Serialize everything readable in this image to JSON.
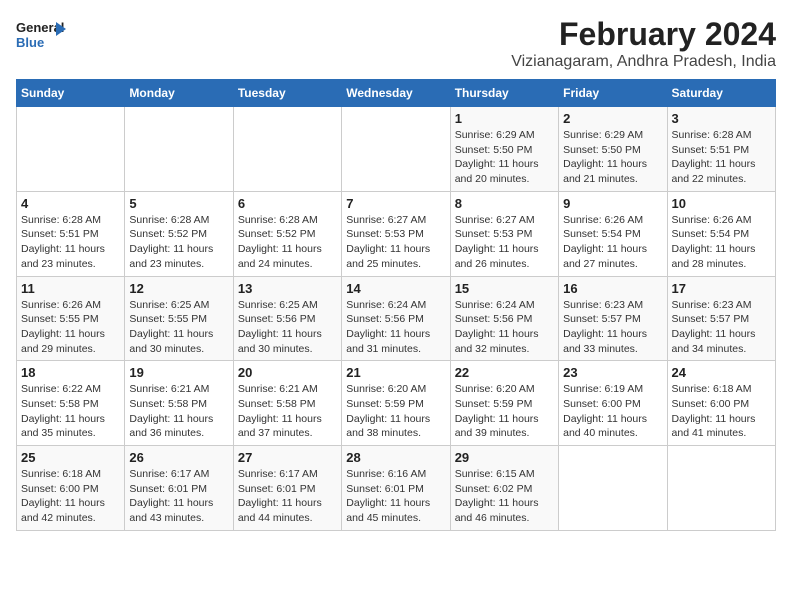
{
  "logo": {
    "general": "General",
    "blue": "Blue"
  },
  "title": "February 2024",
  "subtitle": "Vizianagaram, Andhra Pradesh, India",
  "days_header": [
    "Sunday",
    "Monday",
    "Tuesday",
    "Wednesday",
    "Thursday",
    "Friday",
    "Saturday"
  ],
  "weeks": [
    [
      {
        "day": "",
        "info": ""
      },
      {
        "day": "",
        "info": ""
      },
      {
        "day": "",
        "info": ""
      },
      {
        "day": "",
        "info": ""
      },
      {
        "day": "1",
        "info": "Sunrise: 6:29 AM\nSunset: 5:50 PM\nDaylight: 11 hours and 20 minutes."
      },
      {
        "day": "2",
        "info": "Sunrise: 6:29 AM\nSunset: 5:50 PM\nDaylight: 11 hours and 21 minutes."
      },
      {
        "day": "3",
        "info": "Sunrise: 6:28 AM\nSunset: 5:51 PM\nDaylight: 11 hours and 22 minutes."
      }
    ],
    [
      {
        "day": "4",
        "info": "Sunrise: 6:28 AM\nSunset: 5:51 PM\nDaylight: 11 hours and 23 minutes."
      },
      {
        "day": "5",
        "info": "Sunrise: 6:28 AM\nSunset: 5:52 PM\nDaylight: 11 hours and 23 minutes."
      },
      {
        "day": "6",
        "info": "Sunrise: 6:28 AM\nSunset: 5:52 PM\nDaylight: 11 hours and 24 minutes."
      },
      {
        "day": "7",
        "info": "Sunrise: 6:27 AM\nSunset: 5:53 PM\nDaylight: 11 hours and 25 minutes."
      },
      {
        "day": "8",
        "info": "Sunrise: 6:27 AM\nSunset: 5:53 PM\nDaylight: 11 hours and 26 minutes."
      },
      {
        "day": "9",
        "info": "Sunrise: 6:26 AM\nSunset: 5:54 PM\nDaylight: 11 hours and 27 minutes."
      },
      {
        "day": "10",
        "info": "Sunrise: 6:26 AM\nSunset: 5:54 PM\nDaylight: 11 hours and 28 minutes."
      }
    ],
    [
      {
        "day": "11",
        "info": "Sunrise: 6:26 AM\nSunset: 5:55 PM\nDaylight: 11 hours and 29 minutes."
      },
      {
        "day": "12",
        "info": "Sunrise: 6:25 AM\nSunset: 5:55 PM\nDaylight: 11 hours and 30 minutes."
      },
      {
        "day": "13",
        "info": "Sunrise: 6:25 AM\nSunset: 5:56 PM\nDaylight: 11 hours and 30 minutes."
      },
      {
        "day": "14",
        "info": "Sunrise: 6:24 AM\nSunset: 5:56 PM\nDaylight: 11 hours and 31 minutes."
      },
      {
        "day": "15",
        "info": "Sunrise: 6:24 AM\nSunset: 5:56 PM\nDaylight: 11 hours and 32 minutes."
      },
      {
        "day": "16",
        "info": "Sunrise: 6:23 AM\nSunset: 5:57 PM\nDaylight: 11 hours and 33 minutes."
      },
      {
        "day": "17",
        "info": "Sunrise: 6:23 AM\nSunset: 5:57 PM\nDaylight: 11 hours and 34 minutes."
      }
    ],
    [
      {
        "day": "18",
        "info": "Sunrise: 6:22 AM\nSunset: 5:58 PM\nDaylight: 11 hours and 35 minutes."
      },
      {
        "day": "19",
        "info": "Sunrise: 6:21 AM\nSunset: 5:58 PM\nDaylight: 11 hours and 36 minutes."
      },
      {
        "day": "20",
        "info": "Sunrise: 6:21 AM\nSunset: 5:58 PM\nDaylight: 11 hours and 37 minutes."
      },
      {
        "day": "21",
        "info": "Sunrise: 6:20 AM\nSunset: 5:59 PM\nDaylight: 11 hours and 38 minutes."
      },
      {
        "day": "22",
        "info": "Sunrise: 6:20 AM\nSunset: 5:59 PM\nDaylight: 11 hours and 39 minutes."
      },
      {
        "day": "23",
        "info": "Sunrise: 6:19 AM\nSunset: 6:00 PM\nDaylight: 11 hours and 40 minutes."
      },
      {
        "day": "24",
        "info": "Sunrise: 6:18 AM\nSunset: 6:00 PM\nDaylight: 11 hours and 41 minutes."
      }
    ],
    [
      {
        "day": "25",
        "info": "Sunrise: 6:18 AM\nSunset: 6:00 PM\nDaylight: 11 hours and 42 minutes."
      },
      {
        "day": "26",
        "info": "Sunrise: 6:17 AM\nSunset: 6:01 PM\nDaylight: 11 hours and 43 minutes."
      },
      {
        "day": "27",
        "info": "Sunrise: 6:17 AM\nSunset: 6:01 PM\nDaylight: 11 hours and 44 minutes."
      },
      {
        "day": "28",
        "info": "Sunrise: 6:16 AM\nSunset: 6:01 PM\nDaylight: 11 hours and 45 minutes."
      },
      {
        "day": "29",
        "info": "Sunrise: 6:15 AM\nSunset: 6:02 PM\nDaylight: 11 hours and 46 minutes."
      },
      {
        "day": "",
        "info": ""
      },
      {
        "day": "",
        "info": ""
      }
    ]
  ]
}
